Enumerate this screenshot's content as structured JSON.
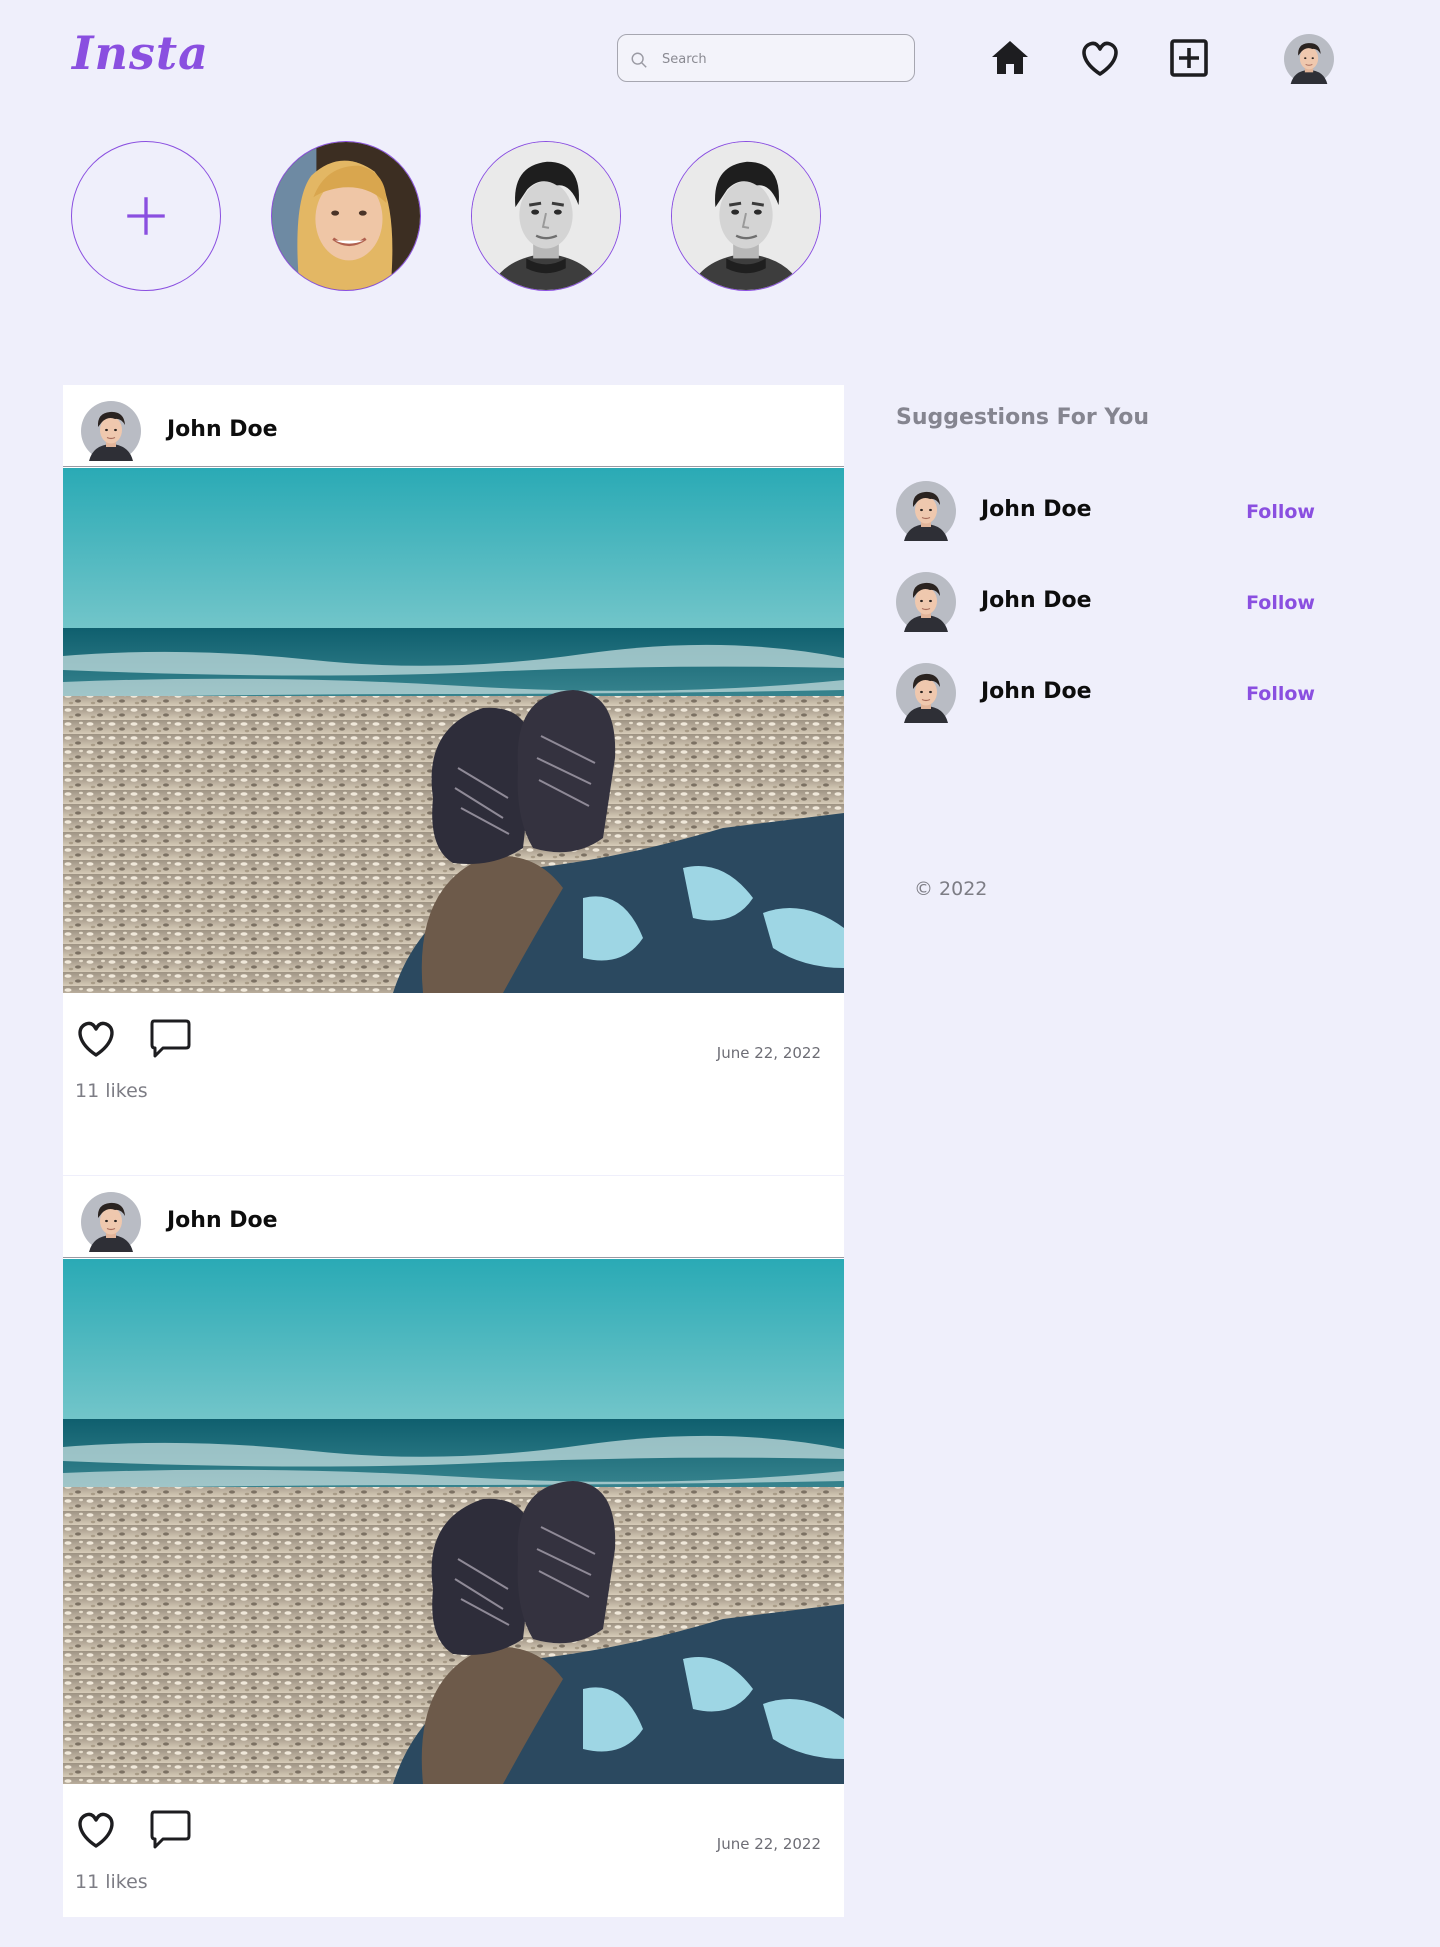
{
  "header": {
    "logo": "Insta",
    "search": {
      "placeholder": "Search",
      "value": ""
    },
    "nav": [
      "home-icon",
      "heart-icon",
      "add-post-icon",
      "profile-avatar"
    ]
  },
  "stories": {
    "add_story": "plus-icon",
    "items": [
      "story-woman",
      "story-man",
      "story-man"
    ]
  },
  "posts": [
    {
      "username": "John Doe",
      "likes": "11 likes",
      "date": "June 22, 2022"
    },
    {
      "username": "John Doe",
      "likes": "11 likes",
      "date": "June 22, 2022"
    }
  ],
  "suggestions": {
    "title": "Suggestions For You",
    "items": [
      {
        "name": "John Doe",
        "action": "Follow"
      },
      {
        "name": "John Doe",
        "action": "Follow"
      },
      {
        "name": "John Doe",
        "action": "Follow"
      }
    ]
  },
  "footer": {
    "copyright": "© 2022"
  },
  "colors": {
    "accent": "#8a4fe0",
    "background": "#efeffb",
    "card": "#ffffff"
  }
}
